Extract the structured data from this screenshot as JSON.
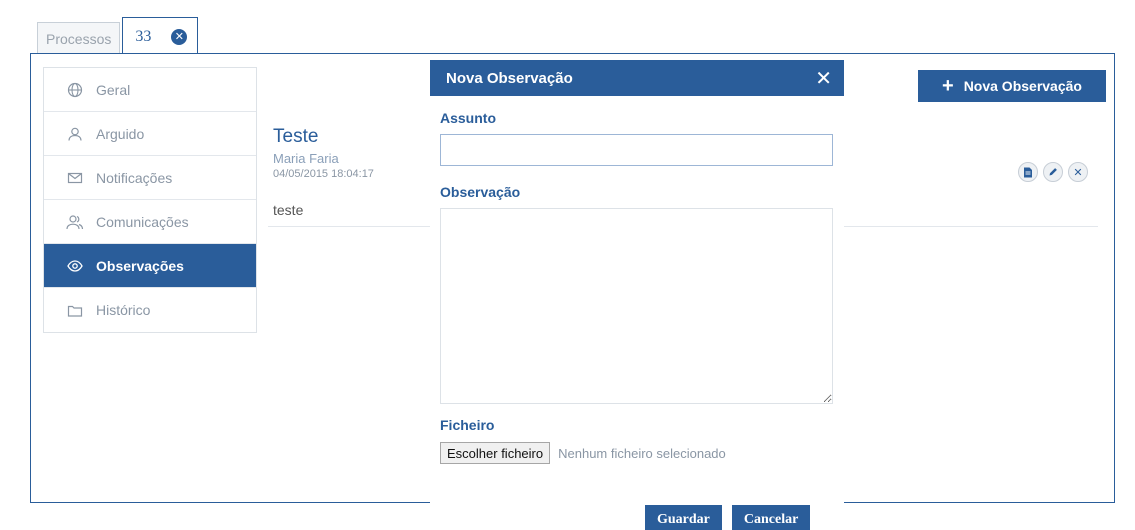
{
  "tabs": [
    {
      "label": "Processos"
    },
    {
      "label": "33"
    }
  ],
  "sidebar": {
    "items": [
      {
        "label": "Geral",
        "icon": "globe-icon"
      },
      {
        "label": "Arguido",
        "icon": "user-icon"
      },
      {
        "label": "Notificações",
        "icon": "envelope-icon"
      },
      {
        "label": "Comunicações",
        "icon": "users-icon"
      },
      {
        "label": "Observações",
        "icon": "eye-icon",
        "active": true
      },
      {
        "label": "Histórico",
        "icon": "folder-icon"
      }
    ]
  },
  "observation": {
    "title": "Teste",
    "author": "Maria Faria",
    "date": "04/05/2015 18:04:17",
    "text": "teste"
  },
  "toolbar": {
    "new_label": "Nova Observação"
  },
  "modal": {
    "title": "Nova Observação",
    "subject_label": "Assunto",
    "subject_value": "",
    "observation_label": "Observação",
    "file_label": "Ficheiro",
    "file_button": "Escolher ficheiro",
    "file_none": "Nenhum ficheiro selecionado",
    "save_label": "Guardar",
    "cancel_label": "Cancelar"
  },
  "colors": {
    "primary": "#2a5d9a"
  }
}
